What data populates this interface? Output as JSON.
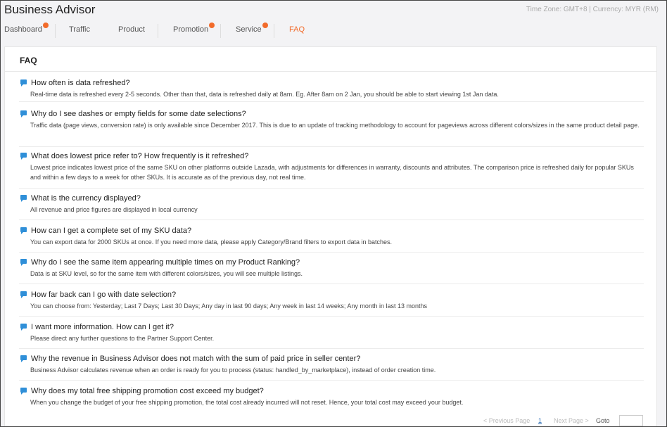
{
  "header": {
    "title": "Business Advisor",
    "timezone": "Time Zone: GMT+8 | Currency: MYR (RM)"
  },
  "tabs": [
    {
      "label": "Dashboard",
      "dot": true,
      "active": false
    },
    {
      "label": "Traffic",
      "dot": false,
      "active": false
    },
    {
      "label": "Product",
      "dot": false,
      "active": false
    },
    {
      "label": "Promotion",
      "dot": true,
      "active": false
    },
    {
      "label": "Service",
      "dot": true,
      "active": false
    },
    {
      "label": "FAQ",
      "dot": false,
      "active": true
    }
  ],
  "panel": {
    "title": "FAQ"
  },
  "faq": [
    {
      "q": "How often is data refreshed?",
      "a": "Real-time data is refreshed every 2-5 seconds. Other than that, data is refreshed daily at 8am. Eg. After 8am on 2 Jan, you should be able to start viewing 1st Jan data."
    },
    {
      "q": "Why do I see dashes or empty fields for some date selections?",
      "a": "Traffic data (page views, conversion rate) is only available since December 2017. This is due to an update of tracking methodology to account for pageviews across different colors/sizes in the same product detail page."
    },
    {
      "q": "What does lowest price refer to? How frequently is it refreshed?",
      "a": "Lowest price indicates lowest price of the same SKU on other platforms outside Lazada, with adjustments for differences in warranty, discounts and attributes. The comparison price is refreshed daily for popular SKUs and within a few days to a week for other SKUs. It is accurate as of the previous day, not real time."
    },
    {
      "q": "What is the currency displayed?",
      "a": "All revenue and price figures are displayed in local currency"
    },
    {
      "q": "How can I get a complete set of my SKU data?",
      "a": "You can export data for 2000 SKUs at once. If you need more data, please apply Category/Brand filters to export data in batches."
    },
    {
      "q": "Why do I see the same item appearing multiple times on my Product Ranking?",
      "a": "Data is at SKU level, so for the same item with different colors/sizes, you will see multiple listings."
    },
    {
      "q": "How far back can I go with date selection?",
      "a": "You can choose from: Yesterday; Last 7 Days; Last 30 Days; Any day in last 90 days; Any week in last 14 weeks; Any month in last 13 months"
    },
    {
      "q": "I want more information. How can I get it?",
      "a": "Please direct any further questions to the Partner Support Center."
    },
    {
      "q": "Why the revenue in Business Advisor does not match with the sum of paid price in seller center?",
      "a": "Business Advisor calculates revenue when an order is ready for you to process (status: handled_by_marketplace), instead of order creation time."
    },
    {
      "q": "Why does my total free shipping promotion cost exceed my budget?",
      "a": "When you change the budget of your free shipping promotion, the total cost already incurred will not reset. Hence, your total cost may exceed your budget."
    }
  ],
  "pager": {
    "prev": "< Previous Page",
    "current": "1",
    "next": "Next Page >",
    "goto": "Goto"
  },
  "colors": {
    "accent": "#f26b2a",
    "icon": "#2f8fd8"
  }
}
